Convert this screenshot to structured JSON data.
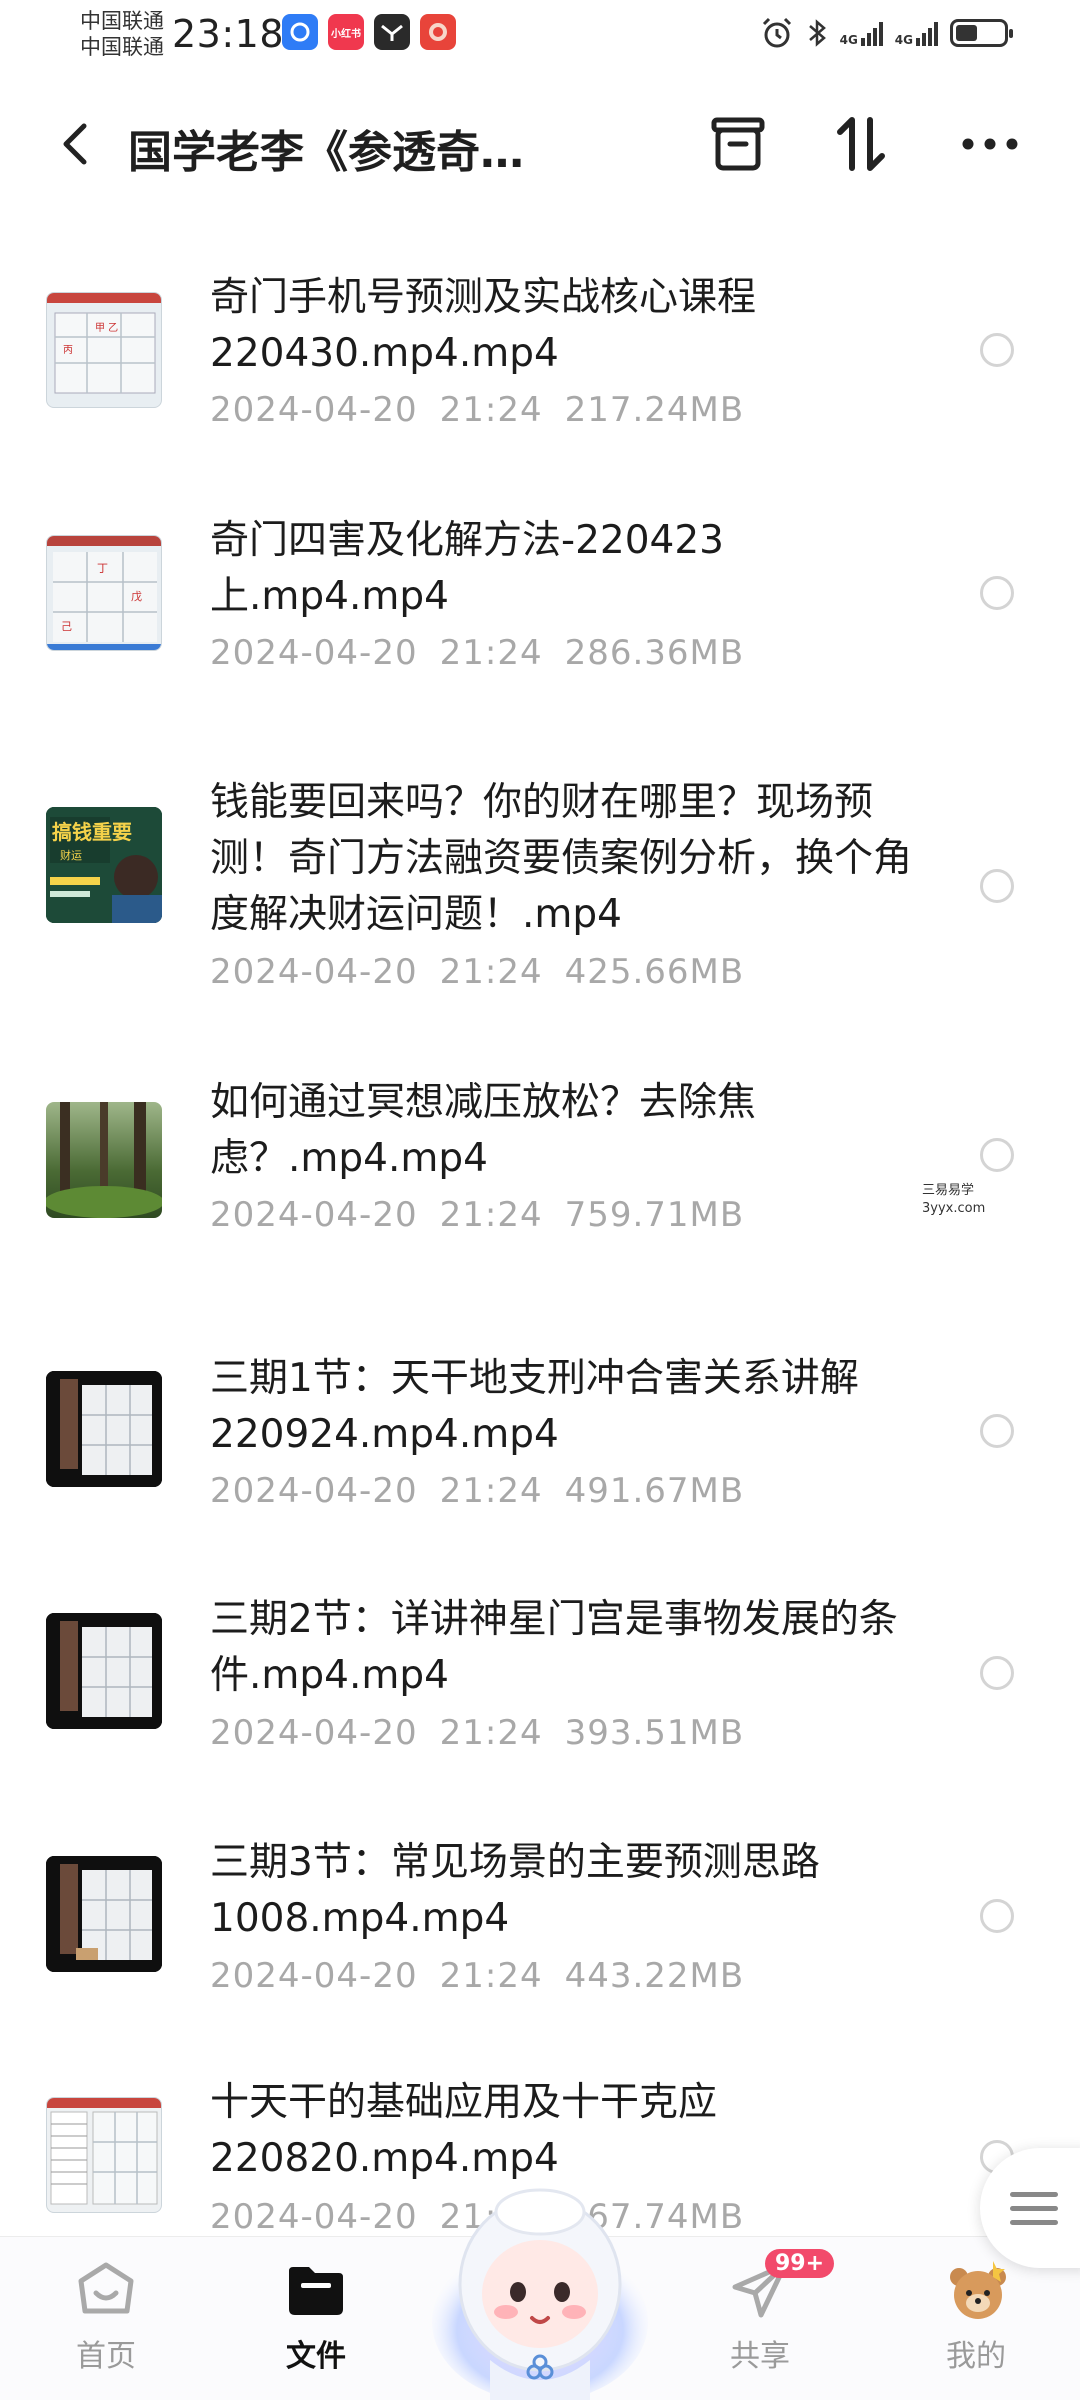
{
  "status_bar": {
    "carrier_1": "中国联通",
    "carrier_2": "中国联通",
    "time": "23:18",
    "network_1": "4G",
    "network_2": "4G",
    "app_icon_label": "小红书",
    "icons": [
      "alarm-icon",
      "bluetooth-icon",
      "signal-icon",
      "battery-icon"
    ]
  },
  "header": {
    "title": "国学老李《参透奇…",
    "back_icon": "chevron-left-icon",
    "actions": [
      "archive-icon",
      "sort-icon",
      "more-icon"
    ]
  },
  "files": [
    {
      "name": "奇门手机号预测及实战核心课程220430.mp4.mp4",
      "date": "2024-04-20",
      "time": "21:24",
      "size": "217.24MB",
      "thumb": "whiteboard"
    },
    {
      "name": "奇门四害及化解方法-220423上.mp4.mp4",
      "date": "2024-04-20",
      "time": "21:24",
      "size": "286.36MB",
      "thumb": "whiteboard-red"
    },
    {
      "name": "钱能要回来吗？你的财在哪里？现场预测！奇门方法融资要债案例分析，换个角度解决财运问题！.mp4",
      "date": "2024-04-20",
      "time": "21:24",
      "size": "425.66MB",
      "thumb": "poster"
    },
    {
      "name": "如何通过冥想减压放松？去除焦虑？.mp4.mp4",
      "date": "2024-04-20",
      "time": "21:24",
      "size": "759.71MB",
      "thumb": "forest"
    },
    {
      "name": "三期1节：天干地支刑冲合害关系讲解220924.mp4.mp4",
      "date": "2024-04-20",
      "time": "21:24",
      "size": "491.67MB",
      "thumb": "classroom"
    },
    {
      "name": "三期2节：详讲神星门宫是事物发展的条件.mp4.mp4",
      "date": "2024-04-20",
      "time": "21:24",
      "size": "393.51MB",
      "thumb": "classroom"
    },
    {
      "name": "三期3节：常见场景的主要预测思路1008.mp4.mp4",
      "date": "2024-04-20",
      "time": "21:24",
      "size": "443.22MB",
      "thumb": "classroom"
    },
    {
      "name": "十天干的基础应用及十干克应220820.mp4.mp4",
      "date": "2024-04-20",
      "time": "21:24",
      "size": "167.74MB",
      "thumb": "whiteboard-table"
    }
  ],
  "poster_text": "搞钱重要",
  "watermark": {
    "line1": "三易易学",
    "line2": "3yyx.com"
  },
  "nav": {
    "home": "首页",
    "files": "文件",
    "share": "共享",
    "mine": "我的",
    "share_badge": "99+"
  }
}
